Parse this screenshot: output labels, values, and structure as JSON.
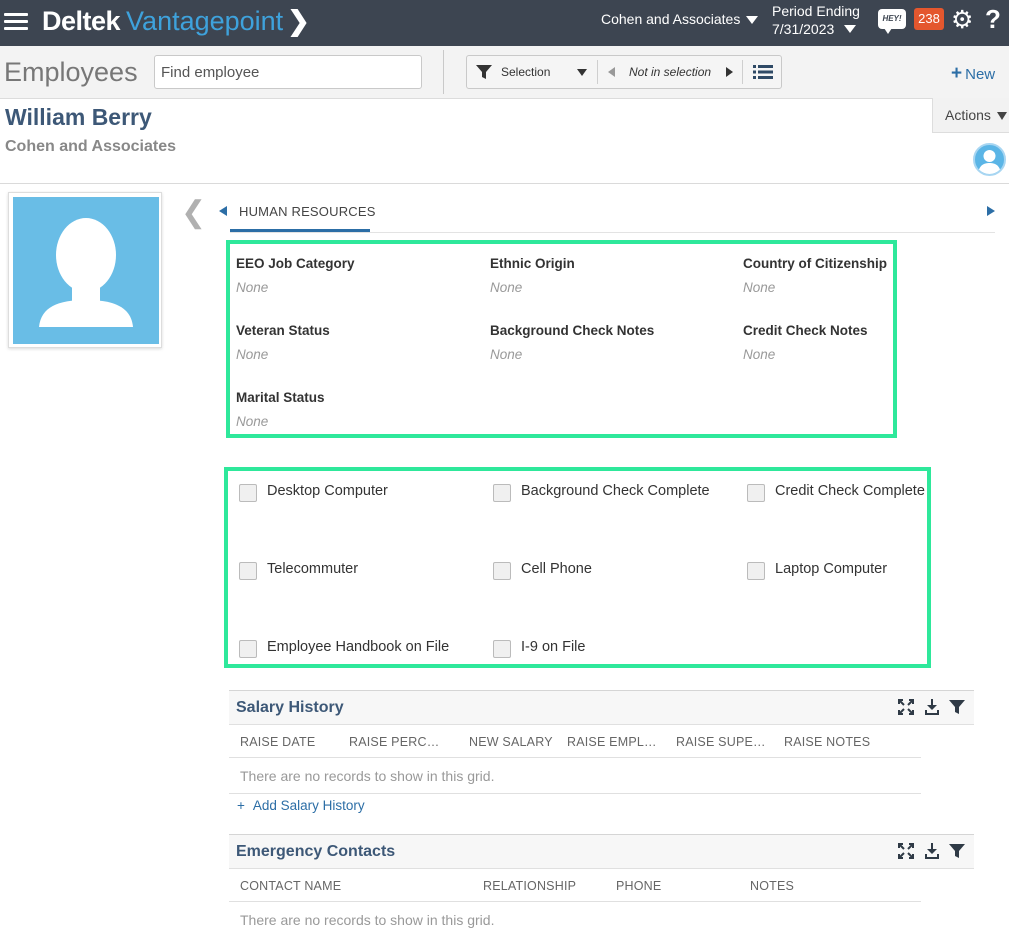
{
  "topbar": {
    "brand_first": "Deltek",
    "brand_second": "Vantagepoint",
    "company": "Cohen and Associates",
    "period_label": "Period Ending",
    "period_date": "7/31/2023",
    "hey_label": "HEY!",
    "notification_count": "238"
  },
  "subbar": {
    "page_title": "Employees",
    "search_placeholder": "Find employee",
    "selection_label": "Selection",
    "not_in_selection": "Not in selection",
    "new_label": "New"
  },
  "record": {
    "name": "William Berry",
    "company": "Cohen and Associates",
    "actions_label": "Actions"
  },
  "tabs": {
    "active": "HUMAN RESOURCES"
  },
  "hr_fields": [
    {
      "label": "EEO Job Category",
      "value": "None"
    },
    {
      "label": "Ethnic Origin",
      "value": "None"
    },
    {
      "label": "Country of Citizenship",
      "value": "None"
    },
    {
      "label": "Veteran Status",
      "value": "None"
    },
    {
      "label": "Background Check Notes",
      "value": "None"
    },
    {
      "label": "Credit Check Notes",
      "value": "None"
    },
    {
      "label": "Marital Status",
      "value": "None"
    }
  ],
  "checkboxes": [
    {
      "label": "Desktop Computer",
      "checked": false
    },
    {
      "label": "Background Check Complete",
      "checked": false
    },
    {
      "label": "Credit Check Complete",
      "checked": false
    },
    {
      "label": "Telecommuter",
      "checked": false
    },
    {
      "label": "Cell Phone",
      "checked": false
    },
    {
      "label": "Laptop Computer",
      "checked": false
    },
    {
      "label": "Employee Handbook on File",
      "checked": false
    },
    {
      "label": "I-9 on File",
      "checked": false
    }
  ],
  "salary_history": {
    "title": "Salary History",
    "columns": [
      "RAISE DATE",
      "RAISE PERC…",
      "NEW SALARY",
      "RAISE EMPL…",
      "RAISE SUPE…",
      "RAISE NOTES"
    ],
    "empty_text": "There are no records to show in this grid.",
    "add_label": "Add Salary History"
  },
  "emergency_contacts": {
    "title": "Emergency Contacts",
    "columns": [
      "CONTACT NAME",
      "RELATIONSHIP",
      "PHONE",
      "NOTES"
    ],
    "empty_text": "There are no records to show in this grid."
  },
  "colors": {
    "topbar_bg": "#3d4551",
    "brand_blue": "#3ea2dc",
    "badge_orange": "#e4572e",
    "highlight_green": "#2ee89b",
    "link_blue": "#2c6ea6",
    "title_navy": "#3d5877"
  }
}
